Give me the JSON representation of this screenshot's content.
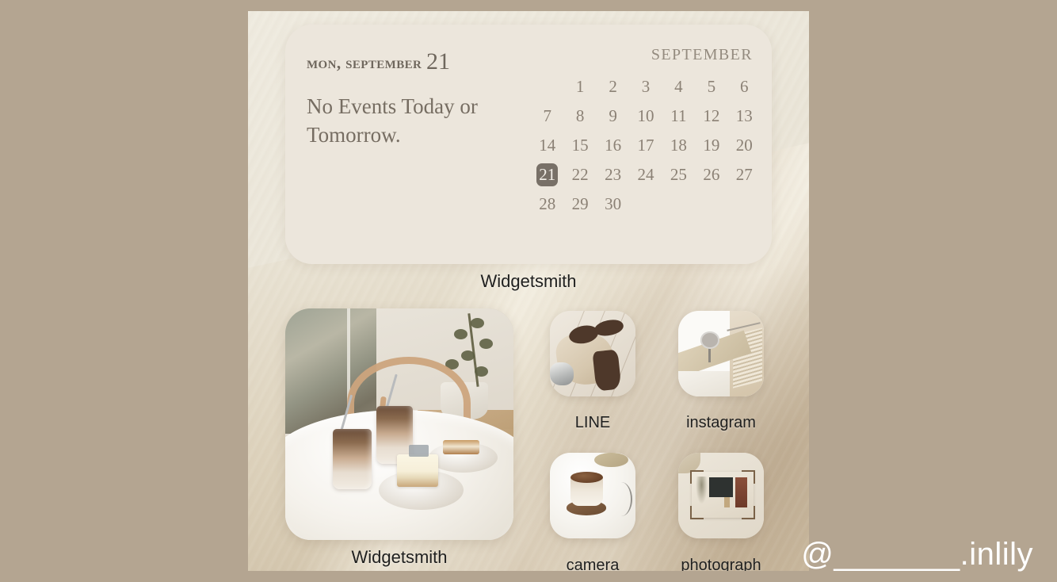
{
  "colors": {
    "canvas_background": "#b4a591",
    "widget_card": "#ece6dc",
    "wallpaper_base": "#e3dece",
    "text_muted": "#8b8175",
    "today_highlight": "#787067",
    "app_label": "#20201f",
    "watermark": "#ffffff"
  },
  "calendar_widget": {
    "title_prefix": "Mon, September",
    "title_day": "21",
    "events_text": "No Events Today or Tomorrow.",
    "month_label": "SEPTEMBER",
    "leading_blanks": 1,
    "days": [
      1,
      2,
      3,
      4,
      5,
      6,
      7,
      8,
      9,
      10,
      11,
      12,
      13,
      14,
      15,
      16,
      17,
      18,
      19,
      20,
      21,
      22,
      23,
      24,
      25,
      26,
      27,
      28,
      29,
      30
    ],
    "today": 21,
    "app_label": "Widgetsmith"
  },
  "photo_widget": {
    "app_label": "Widgetsmith",
    "image_description": "cafe table with two iced lattes and cake"
  },
  "app_icons": [
    {
      "label": "LINE",
      "icon_name": "line-app-icon",
      "image_description": "brown loafers and knit sweater on pale wood floor"
    },
    {
      "label": "instagram",
      "icon_name": "instagram-app-icon",
      "image_description": "white building with round sign and stair ramp"
    },
    {
      "label": "camera",
      "icon_name": "camera-app-icon",
      "image_description": "iced latte cup on white table"
    },
    {
      "label": "photograph",
      "icon_name": "photograph-app-icon",
      "image_description": "framed photo of a storefront"
    }
  ],
  "watermark": {
    "text": "@_______.inlily"
  }
}
